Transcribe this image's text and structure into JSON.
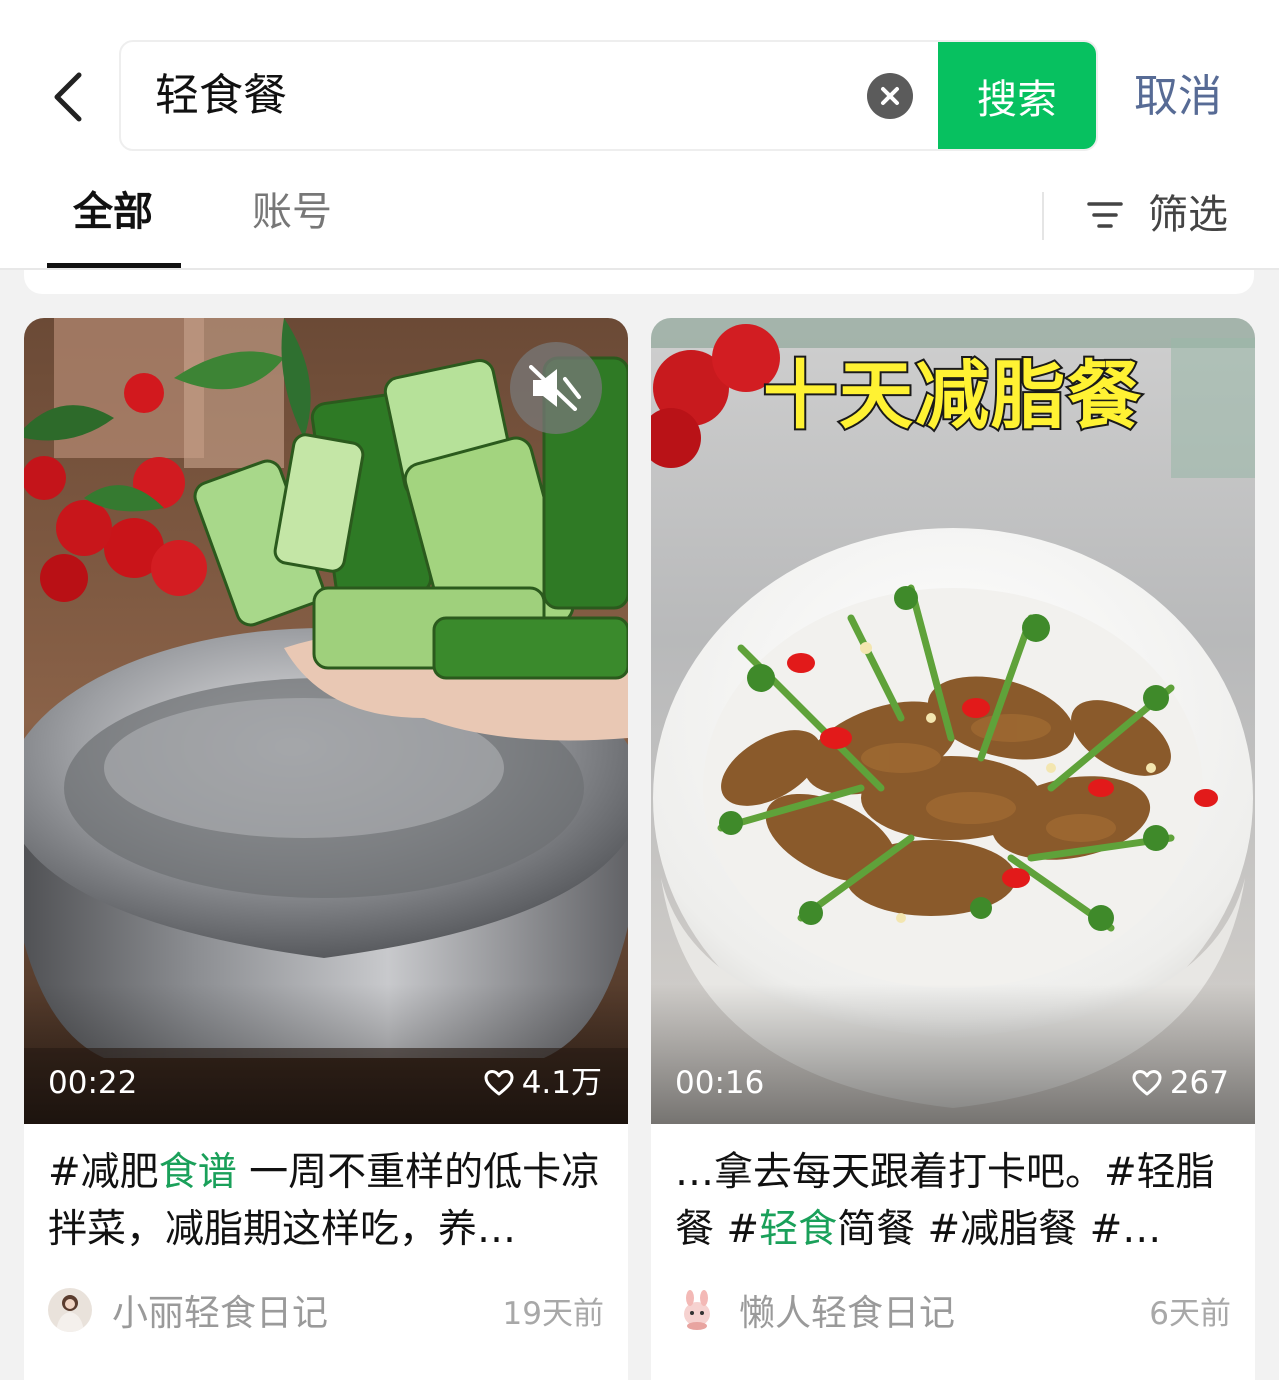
{
  "search": {
    "query": "轻食餐",
    "button_label": "搜索",
    "cancel_label": "取消"
  },
  "tabs": [
    {
      "label": "全部",
      "active": true
    },
    {
      "label": "账号",
      "active": false
    }
  ],
  "filter_label": "筛选",
  "icons": {
    "back": "chevron-left-icon",
    "clear": "close-circle-icon",
    "filter": "filter-icon",
    "mute": "speaker-muted-icon",
    "like": "heart-icon"
  },
  "colors": {
    "accent": "#07c160",
    "cancel_link": "#576b95",
    "hashtag_highlight": "#1aa05a"
  },
  "cards": [
    {
      "duration": "00:22",
      "likes": "4.1万",
      "muted": true,
      "caption_pre": "#减肥",
      "caption_hl": "食谱",
      "caption_post": " 一周不重样的低卡凉拌菜，减脂期这样吃，养…",
      "author": "小丽轻食日记",
      "time": "19天前"
    },
    {
      "duration": "00:16",
      "likes": "267",
      "cover_title": "十天减脂餐",
      "caption_pre": "…拿去每天跟着打卡吧。#轻脂餐 #",
      "caption_hl": "轻食",
      "caption_post": "简餐 #减脂餐 #…",
      "author": "懒人轻食日记",
      "time": "6天前"
    }
  ]
}
